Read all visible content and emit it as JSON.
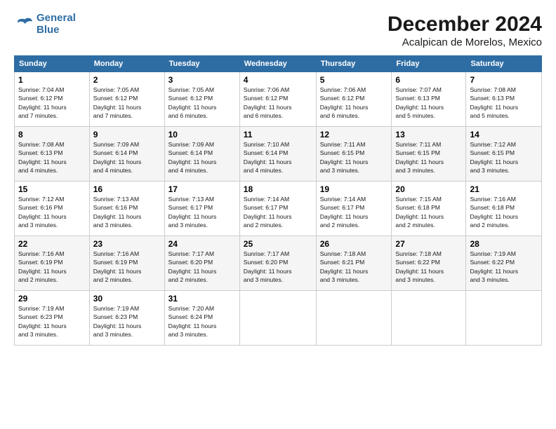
{
  "logo": {
    "line1": "General",
    "line2": "Blue"
  },
  "title": "December 2024",
  "subtitle": "Acalpican de Morelos, Mexico",
  "days_of_week": [
    "Sunday",
    "Monday",
    "Tuesday",
    "Wednesday",
    "Thursday",
    "Friday",
    "Saturday"
  ],
  "weeks": [
    [
      {
        "day": "1",
        "info": "Sunrise: 7:04 AM\nSunset: 6:12 PM\nDaylight: 11 hours\nand 7 minutes."
      },
      {
        "day": "2",
        "info": "Sunrise: 7:05 AM\nSunset: 6:12 PM\nDaylight: 11 hours\nand 7 minutes."
      },
      {
        "day": "3",
        "info": "Sunrise: 7:05 AM\nSunset: 6:12 PM\nDaylight: 11 hours\nand 6 minutes."
      },
      {
        "day": "4",
        "info": "Sunrise: 7:06 AM\nSunset: 6:12 PM\nDaylight: 11 hours\nand 6 minutes."
      },
      {
        "day": "5",
        "info": "Sunrise: 7:06 AM\nSunset: 6:12 PM\nDaylight: 11 hours\nand 6 minutes."
      },
      {
        "day": "6",
        "info": "Sunrise: 7:07 AM\nSunset: 6:13 PM\nDaylight: 11 hours\nand 5 minutes."
      },
      {
        "day": "7",
        "info": "Sunrise: 7:08 AM\nSunset: 6:13 PM\nDaylight: 11 hours\nand 5 minutes."
      }
    ],
    [
      {
        "day": "8",
        "info": "Sunrise: 7:08 AM\nSunset: 6:13 PM\nDaylight: 11 hours\nand 4 minutes."
      },
      {
        "day": "9",
        "info": "Sunrise: 7:09 AM\nSunset: 6:14 PM\nDaylight: 11 hours\nand 4 minutes."
      },
      {
        "day": "10",
        "info": "Sunrise: 7:09 AM\nSunset: 6:14 PM\nDaylight: 11 hours\nand 4 minutes."
      },
      {
        "day": "11",
        "info": "Sunrise: 7:10 AM\nSunset: 6:14 PM\nDaylight: 11 hours\nand 4 minutes."
      },
      {
        "day": "12",
        "info": "Sunrise: 7:11 AM\nSunset: 6:15 PM\nDaylight: 11 hours\nand 3 minutes."
      },
      {
        "day": "13",
        "info": "Sunrise: 7:11 AM\nSunset: 6:15 PM\nDaylight: 11 hours\nand 3 minutes."
      },
      {
        "day": "14",
        "info": "Sunrise: 7:12 AM\nSunset: 6:15 PM\nDaylight: 11 hours\nand 3 minutes."
      }
    ],
    [
      {
        "day": "15",
        "info": "Sunrise: 7:12 AM\nSunset: 6:16 PM\nDaylight: 11 hours\nand 3 minutes."
      },
      {
        "day": "16",
        "info": "Sunrise: 7:13 AM\nSunset: 6:16 PM\nDaylight: 11 hours\nand 3 minutes."
      },
      {
        "day": "17",
        "info": "Sunrise: 7:13 AM\nSunset: 6:17 PM\nDaylight: 11 hours\nand 3 minutes."
      },
      {
        "day": "18",
        "info": "Sunrise: 7:14 AM\nSunset: 6:17 PM\nDaylight: 11 hours\nand 2 minutes."
      },
      {
        "day": "19",
        "info": "Sunrise: 7:14 AM\nSunset: 6:17 PM\nDaylight: 11 hours\nand 2 minutes."
      },
      {
        "day": "20",
        "info": "Sunrise: 7:15 AM\nSunset: 6:18 PM\nDaylight: 11 hours\nand 2 minutes."
      },
      {
        "day": "21",
        "info": "Sunrise: 7:16 AM\nSunset: 6:18 PM\nDaylight: 11 hours\nand 2 minutes."
      }
    ],
    [
      {
        "day": "22",
        "info": "Sunrise: 7:16 AM\nSunset: 6:19 PM\nDaylight: 11 hours\nand 2 minutes."
      },
      {
        "day": "23",
        "info": "Sunrise: 7:16 AM\nSunset: 6:19 PM\nDaylight: 11 hours\nand 2 minutes."
      },
      {
        "day": "24",
        "info": "Sunrise: 7:17 AM\nSunset: 6:20 PM\nDaylight: 11 hours\nand 2 minutes."
      },
      {
        "day": "25",
        "info": "Sunrise: 7:17 AM\nSunset: 6:20 PM\nDaylight: 11 hours\nand 3 minutes."
      },
      {
        "day": "26",
        "info": "Sunrise: 7:18 AM\nSunset: 6:21 PM\nDaylight: 11 hours\nand 3 minutes."
      },
      {
        "day": "27",
        "info": "Sunrise: 7:18 AM\nSunset: 6:22 PM\nDaylight: 11 hours\nand 3 minutes."
      },
      {
        "day": "28",
        "info": "Sunrise: 7:19 AM\nSunset: 6:22 PM\nDaylight: 11 hours\nand 3 minutes."
      }
    ],
    [
      {
        "day": "29",
        "info": "Sunrise: 7:19 AM\nSunset: 6:23 PM\nDaylight: 11 hours\nand 3 minutes."
      },
      {
        "day": "30",
        "info": "Sunrise: 7:19 AM\nSunset: 6:23 PM\nDaylight: 11 hours\nand 3 minutes."
      },
      {
        "day": "31",
        "info": "Sunrise: 7:20 AM\nSunset: 6:24 PM\nDaylight: 11 hours\nand 3 minutes."
      },
      {
        "day": "",
        "info": ""
      },
      {
        "day": "",
        "info": ""
      },
      {
        "day": "",
        "info": ""
      },
      {
        "day": "",
        "info": ""
      }
    ]
  ]
}
